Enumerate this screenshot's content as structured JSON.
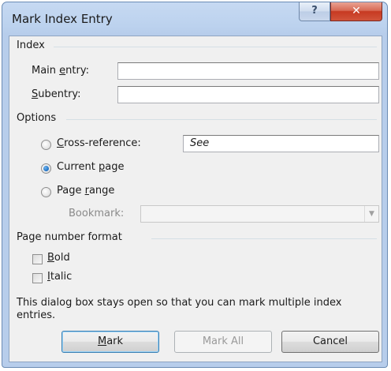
{
  "window": {
    "title": "Mark Index Entry",
    "help_glyph": "?",
    "close_glyph": "✕"
  },
  "index_group": {
    "label": "Index",
    "main_entry_label_pre": "Main ",
    "main_entry_label_ul": "e",
    "main_entry_label_post": "ntry:",
    "main_entry_value": "",
    "subentry_label_ul": "S",
    "subentry_label_post": "ubentry:",
    "subentry_value": ""
  },
  "options_group": {
    "label": "Options",
    "cross_reference": {
      "label_ul": "C",
      "label_post": "ross-reference:",
      "value": "See",
      "checked": false
    },
    "current_page": {
      "label_pre": "Current ",
      "label_ul": "p",
      "label_post": "age",
      "checked": true
    },
    "page_range": {
      "label_pre": "Page ",
      "label_ul": "r",
      "label_post": "ange",
      "checked": false
    },
    "bookmark": {
      "label": "Bookmark:",
      "value": ""
    }
  },
  "page_number_format": {
    "label": "Page number format",
    "bold": {
      "label_ul": "B",
      "label_post": "old",
      "checked": false
    },
    "italic": {
      "label_ul": "I",
      "label_post": "talic",
      "checked": false
    }
  },
  "info_text": "This dialog box stays open so that you can mark multiple index entries.",
  "buttons": {
    "mark": {
      "label_ul": "M",
      "label_post": "ark"
    },
    "mark_all": {
      "label": "Mark All"
    },
    "cancel": {
      "label": "Cancel"
    }
  }
}
